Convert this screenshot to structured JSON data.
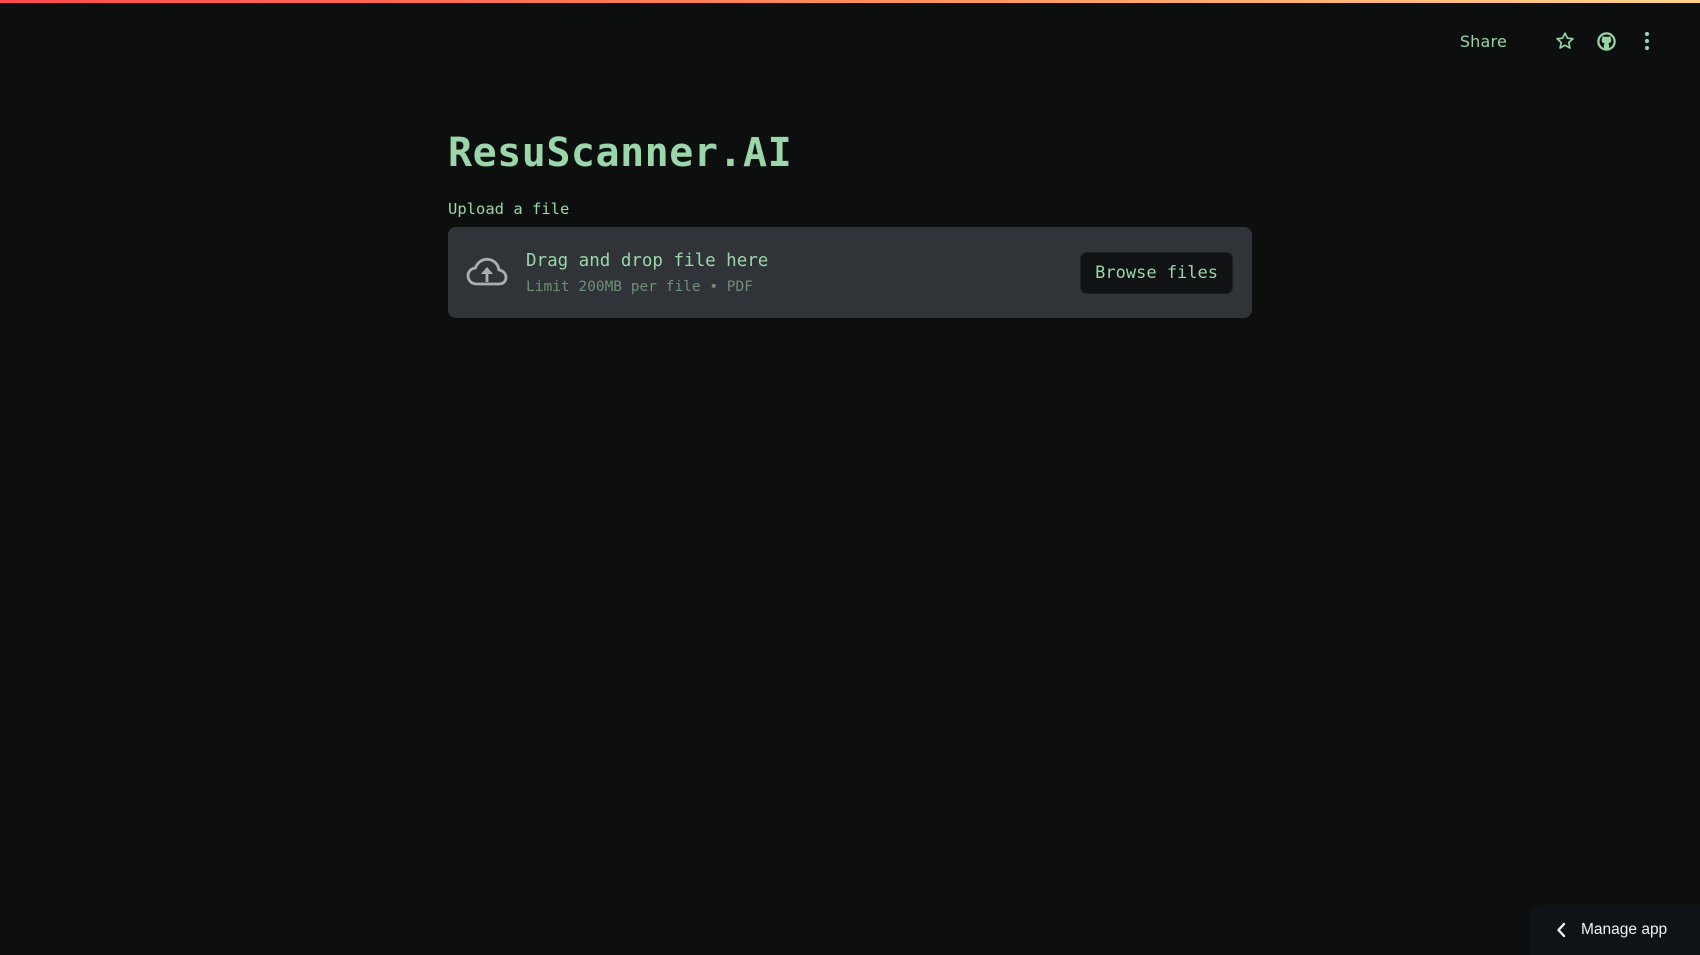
{
  "header": {
    "share_label": "Share",
    "icons": [
      "star-icon",
      "github-icon",
      "more-vertical-icon"
    ]
  },
  "main": {
    "title": "ResuScanner.AI",
    "upload_label": "Upload a file",
    "dropzone": {
      "icon": "cloud-upload-icon",
      "title": "Drag and drop file here",
      "limit": "Limit 200MB per file • PDF",
      "browse_label": "Browse files"
    }
  },
  "footer": {
    "manage_app_label": "Manage app",
    "icon": "chevron-left-icon"
  },
  "colors": {
    "background": "#0d0f0f",
    "accent_text": "#9ad6aa",
    "dropzone_bg": "#303338",
    "top_bar_gradient": [
      "#ff4b4b",
      "#ffd38a"
    ]
  }
}
